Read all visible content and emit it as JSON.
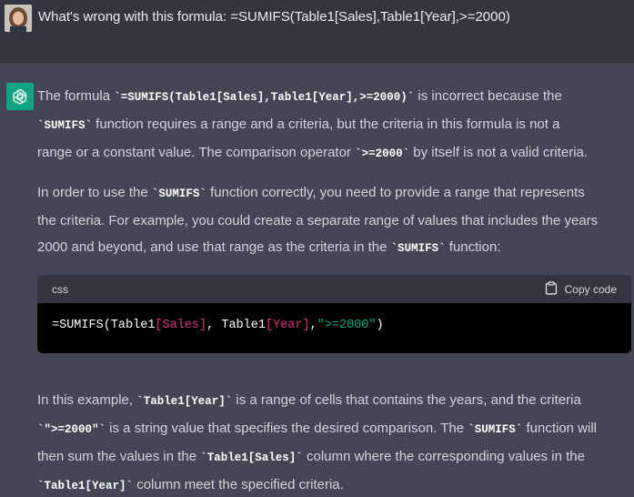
{
  "user": {
    "message": "What's wrong with this formula: =SUMIFS(Table1[Sales],Table1[Year],>=2000)"
  },
  "assistant": {
    "p1": {
      "l1": [
        "The formula ",
        "`=SUMIFS(Table1[Sales],Table1[Year],>=2000)`",
        " is incorrect because the"
      ],
      "l2": [
        "`SUMIFS`",
        " function requires a range and a criteria, but the criteria in this formula is not a"
      ],
      "l3": [
        "range or a constant value. The comparison operator ",
        "`>=2000`",
        " by itself is not a valid criteria."
      ]
    },
    "p2": {
      "l1": [
        "In order to use the ",
        "`SUMIFS`",
        " function correctly, you need to provide a range that represents"
      ],
      "l2": "the criteria. For example, you could create a separate range of values that includes the years",
      "l3": [
        "2000 and beyond, and use that range as the criteria in the ",
        "`SUMIFS`",
        " function:"
      ]
    },
    "code": {
      "language": "css",
      "copy_label": "Copy code",
      "tokens": [
        "=SUMIFS(Table1",
        "[Sales]",
        ", Table1",
        "[Year]",
        ",",
        "\">=2000\"",
        ")"
      ]
    },
    "p3": {
      "l1": [
        "In this example, ",
        "`Table1[Year]`",
        " is a range of cells that contains the years, and the criteria"
      ],
      "l2": [
        "`\">=2000\"`",
        " is a string value that specifies the desired comparison. The ",
        "`SUMIFS`",
        " function will"
      ],
      "l3": [
        "then sum the values in the ",
        "`Table1[Sales]`",
        " column where the corresponding values in the"
      ],
      "l4": [
        "`Table1[Year]`",
        " column meet the specified criteria."
      ]
    }
  },
  "colors": {
    "user_bg": "#343541",
    "assistant_bg": "#444654",
    "brand": "#10a37f"
  }
}
